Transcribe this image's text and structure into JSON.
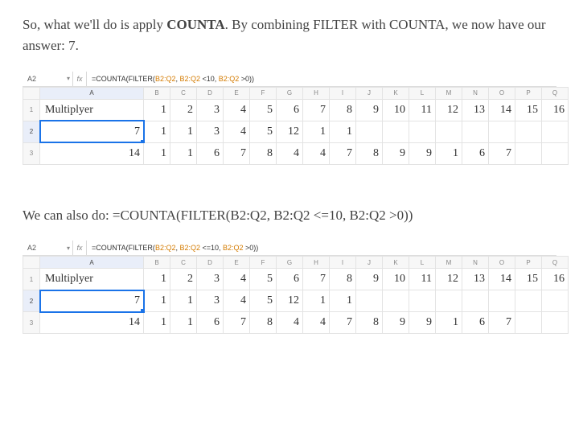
{
  "para1": {
    "t1": "So, what we'll do is apply ",
    "bold": "COUNTA",
    "t2": ". By combining FILTER with COUNTA, we now have our answer: 7."
  },
  "para2": "We can also do: =COUNTA(FILTER(B2:Q2, B2:Q2 <=10, B2:Q2 >0))",
  "sheets": {
    "nameBox": "A2",
    "dropdownGlyph": "▾",
    "fxLabel": "fx",
    "cols": [
      "A",
      "B",
      "C",
      "D",
      "E",
      "F",
      "G",
      "H",
      "I",
      "J",
      "K",
      "L",
      "M",
      "N",
      "O",
      "P",
      "Q"
    ],
    "formula1": {
      "eq": "=",
      "kw1": "COUNTA(FILTER(",
      "r1": "B2:Q2",
      "c1": ", ",
      "r2": "B2:Q2",
      "o1": " <10, ",
      "r3": "B2:Q2",
      "o2": " >0",
      "close": "))"
    },
    "formula2": {
      "eq": "=",
      "kw1": "COUNTA(FILTER(",
      "r1": "B2:Q2",
      "c1": ", ",
      "r2": "B2:Q2",
      "o1": " <=10, ",
      "r3": "B2:Q2",
      "o2": " >0",
      "close": "))"
    },
    "row1": {
      "label": "Multiplyer",
      "vals": [
        "1",
        "2",
        "3",
        "4",
        "5",
        "6",
        "7",
        "8",
        "9",
        "10",
        "11",
        "12",
        "13",
        "14",
        "15",
        "16"
      ]
    },
    "row2": {
      "a": "7",
      "vals": [
        "1",
        "1",
        "3",
        "4",
        "5",
        "12",
        "1",
        "1",
        "",
        "",
        "",
        "",
        "",
        "",
        "",
        ""
      ]
    },
    "row3": {
      "a": "14",
      "vals": [
        "1",
        "1",
        "6",
        "7",
        "8",
        "4",
        "4",
        "7",
        "8",
        "9",
        "9",
        "1",
        "6",
        "7",
        "",
        ""
      ]
    }
  },
  "chart_data": {
    "type": "table",
    "title": "Spreadsheet rows B:Q for multiplyer example",
    "columns": [
      "B",
      "C",
      "D",
      "E",
      "F",
      "G",
      "H",
      "I",
      "J",
      "K",
      "L",
      "M",
      "N",
      "O",
      "P",
      "Q"
    ],
    "row_header": [
      1,
      2,
      3,
      4,
      5,
      6,
      7,
      8,
      9,
      10,
      11,
      12,
      13,
      14,
      15,
      16
    ],
    "rows": [
      {
        "A": 7,
        "B_Q": [
          1,
          1,
          3,
          4,
          5,
          12,
          1,
          1,
          null,
          null,
          null,
          null,
          null,
          null,
          null,
          null
        ]
      },
      {
        "A": 14,
        "B_Q": [
          1,
          1,
          6,
          7,
          8,
          4,
          4,
          7,
          8,
          9,
          9,
          1,
          6,
          7,
          null,
          null
        ]
      }
    ],
    "formula_result_A2": 7
  }
}
